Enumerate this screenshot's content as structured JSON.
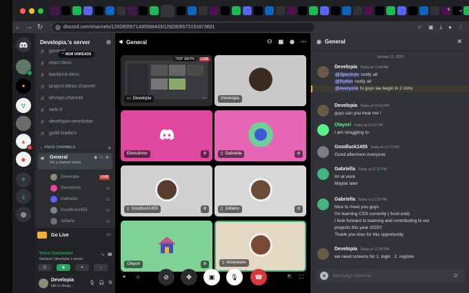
{
  "browser": {
    "url": "discord.com/channels/1292805571430584433/1292805572151873601",
    "tab_icons": [
      "slack-icon",
      "x-icon",
      "spotify-icon",
      "discord-icon",
      "x-icon",
      "linkedin-icon",
      "github-icon"
    ]
  },
  "server": {
    "name": "Developia.'s server",
    "new_unreads": "NEW UNREADS",
    "channels": [
      "general",
      "react-devs",
      "backend-devs",
      "project-ideas-channel",
      "devops-channel",
      "web-3",
      "developia-newsletter",
      "guild-leaders"
    ],
    "voice_header": "VOICE CHANNELS",
    "voice_channel": {
      "name": "General",
      "status_placeholder": "Set a channel status"
    },
    "voice_users": [
      {
        "name": "Developia",
        "live": "LIVE",
        "color": "#8a8d74"
      },
      {
        "name": "Elemsimon",
        "color": "#eb459e"
      },
      {
        "name": "Gabriella",
        "color": "#5865f2"
      },
      {
        "name": "Goodluck1455",
        "color": "#80848e"
      },
      {
        "name": "Jolliano",
        "color": "#6d6f78"
      },
      {
        "name": "Olayori",
        "color": "#57f287"
      }
    ]
  },
  "golive": {
    "label": "Go Live"
  },
  "voice_status": {
    "label": "Voice Connected",
    "sub": "General / developia.'s server"
  },
  "user": {
    "name": "Developia",
    "status": "talk is cheap..."
  },
  "stage": {
    "title": "General",
    "screen_badge": "720P 30FPS",
    "live": "LIVE",
    "tiles": [
      {
        "name": "Developia"
      },
      {
        "name": "Developia"
      },
      {
        "name": "Elemsimon"
      },
      {
        "name": "Gabriella"
      },
      {
        "name": "Goodluck1455"
      },
      {
        "name": "Jolliano"
      },
      {
        "name": "Olayori"
      },
      {
        "name": "toluwalase"
      }
    ]
  },
  "chat": {
    "title": "General",
    "date": "January 15, 2020",
    "input_placeholder": "Message General",
    "messages": [
      {
        "name": "Developia",
        "time": "Today at 11:58 AM",
        "color": "#f2f3f5",
        "lines": [
          [
            "@Spectrum",
            " notify all"
          ],
          [
            "@Rythm",
            " notify all"
          ],
          [
            "@everyone",
            " hi guys we begin in 2 mins"
          ]
        ]
      },
      {
        "name": "Developia",
        "time": "Today at 12:23 PM",
        "color": "#f2f3f5",
        "lines": [
          [
            "",
            "guys can you hear me !"
          ]
        ]
      },
      {
        "name": "Olayori",
        "time": "Today at 12:23 PM",
        "color": "#57f287",
        "lines": [
          [
            "",
            "I am struggling to"
          ]
        ]
      },
      {
        "name": "Goodluck1455",
        "time": "Today at 12:27 PM",
        "color": "#f2f3f5",
        "lines": [
          [
            "",
            "Good afternoon everyone"
          ]
        ]
      },
      {
        "name": "Gabriella",
        "time": "Today at 12:31 PM",
        "color": "#f2f3f5",
        "lines": [
          [
            "",
            "Im at work"
          ],
          [
            "",
            "Maybe later"
          ]
        ]
      },
      {
        "name": "Gabriella",
        "time": "Today at 12:39 PM",
        "color": "#f2f3f5",
        "lines": [
          [
            "",
            "Nice to meet you guys"
          ],
          [
            "",
            "I'm learning CSS currently ( front end)"
          ],
          [
            "",
            "I look forward to learning and contributing to our"
          ],
          [
            "",
            "projects this year 2025!!"
          ],
          [
            "",
            "Thank you Alex for this opportunity."
          ]
        ]
      },
      {
        "name": "Developia",
        "time": "Today at 12:39 PM",
        "color": "#f2f3f5",
        "lines": [
          [
            "",
            "we need screens for 1. login . 2. register"
          ]
        ]
      }
    ]
  }
}
